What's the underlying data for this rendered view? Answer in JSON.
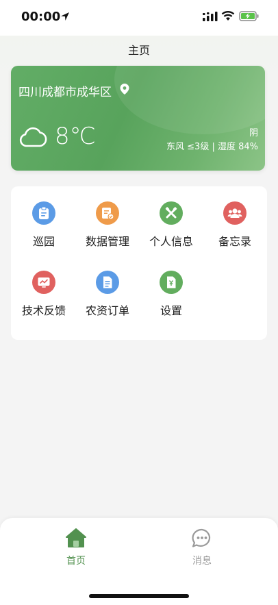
{
  "status_bar": {
    "time": "00:00"
  },
  "header": {
    "title": "主页"
  },
  "weather": {
    "location": "四川成都市成华区",
    "temperature": "8℃",
    "condition": "阴",
    "detail": "东风 ≤3级 | 湿度 84%"
  },
  "menu": {
    "items": [
      {
        "label": "巡园",
        "icon": "clipboard-icon",
        "color": "#5b9be6"
      },
      {
        "label": "数据管理",
        "icon": "data-document-icon",
        "color": "#ef9b4a"
      },
      {
        "label": "个人信息",
        "icon": "tools-icon",
        "color": "#62ad5e"
      },
      {
        "label": "备忘录",
        "icon": "group-icon",
        "color": "#e0615f"
      },
      {
        "label": "技术反馈",
        "icon": "monitor-chart-icon",
        "color": "#e0615f"
      },
      {
        "label": "农资订单",
        "icon": "document-icon",
        "color": "#5b9be6"
      },
      {
        "label": "设置",
        "icon": "yuan-document-icon",
        "color": "#62ad5e"
      }
    ]
  },
  "tabbar": {
    "home_label": "首页",
    "messages_label": "消息",
    "active_color": "#52914f",
    "inactive_color": "#999999"
  }
}
